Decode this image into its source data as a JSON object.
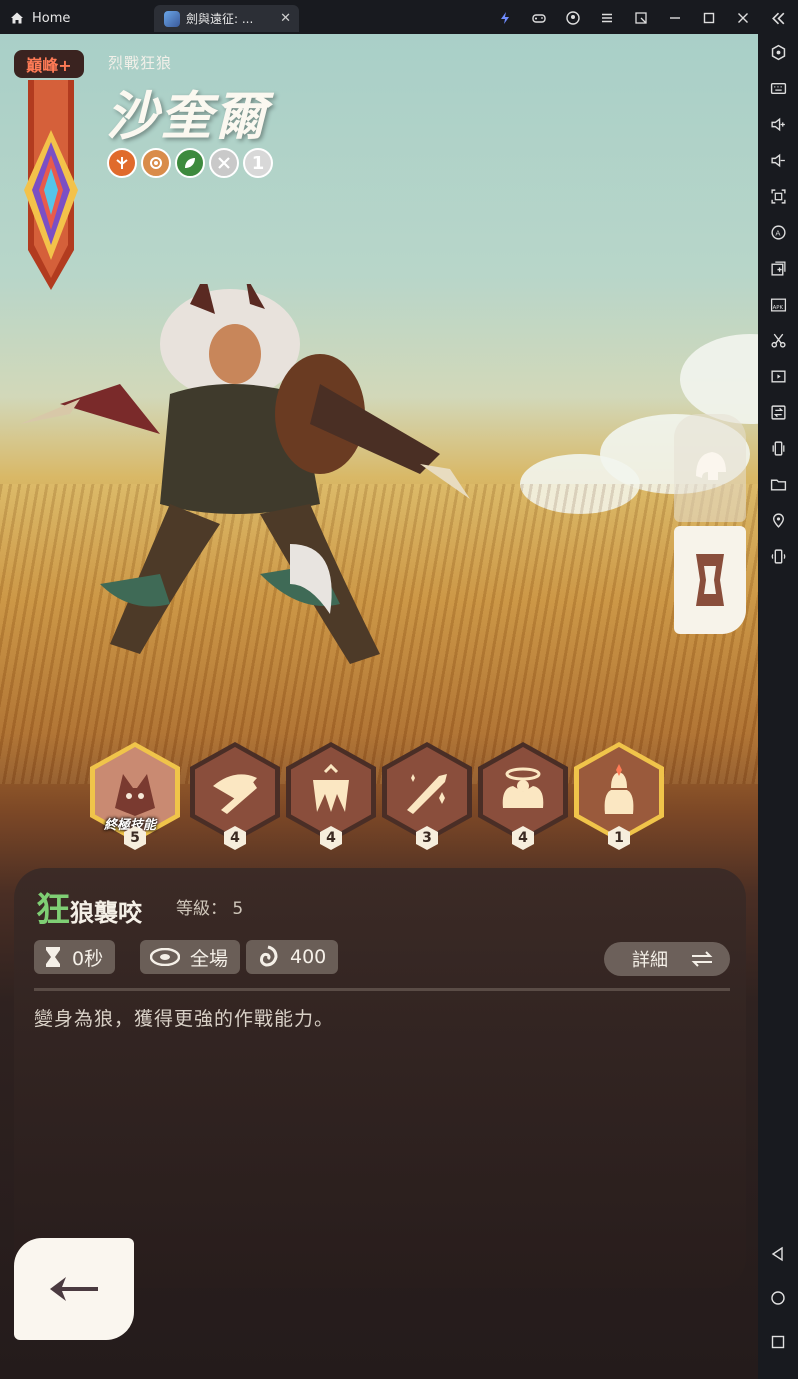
{
  "window": {
    "home_tab_label": "Home",
    "game_tab_label": "劍與遠征: ...",
    "tab_close": "✕"
  },
  "hero": {
    "rank_badge": "巔峰+",
    "subtitle": "烈戰狂狼",
    "name": "沙奎爾",
    "faction_icons": [
      "lightbearer-icon",
      "wilder-icon",
      "leaf-icon",
      "swords-icon",
      "tier-one-icon"
    ],
    "tier_number": "1"
  },
  "skills": [
    {
      "name": "ultimate-skill",
      "level": "5",
      "label": "終極技能",
      "selected": true
    },
    {
      "name": "skill-2",
      "level": "4"
    },
    {
      "name": "skill-3",
      "level": "4"
    },
    {
      "name": "skill-4",
      "level": "3"
    },
    {
      "name": "skill-5",
      "level": "4"
    },
    {
      "name": "signature-skill",
      "level": "1"
    }
  ],
  "skill_info": {
    "title_first": "狂",
    "title_rest": "狼襲咬",
    "level_text": "等級： 5",
    "cooldown": "0秒",
    "range": "全場",
    "energy": "400",
    "details_label": "詳細",
    "description": "變身為狼，獲得更強的作戰能力。"
  },
  "colors": {
    "accent_green": "#7fcf74",
    "badge_red": "#ff7b56",
    "panel_bg": "#3a2a26",
    "hex_gold": "#f0c44a"
  }
}
